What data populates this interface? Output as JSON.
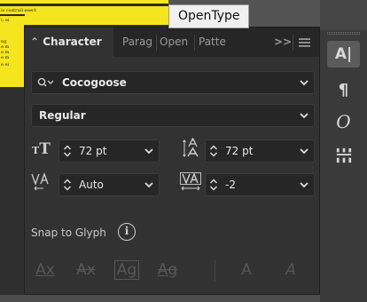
{
  "document": {
    "line1": "is costruil esect",
    "line2": "i: ei",
    "lines_left": [
      "ng",
      "e m",
      "e m",
      "e m",
      "e ei"
    ]
  },
  "tooltip": "OpenType",
  "tabs": [
    {
      "label": "Character"
    },
    {
      "label": "Parag"
    },
    {
      "label": "Open"
    },
    {
      "label": "Patte"
    }
  ],
  "overflow_label": ">>",
  "font_family": "Cocogoose",
  "font_style": "Regular",
  "font_size": "72 pt",
  "leading": "72 pt",
  "kerning": "Auto",
  "tracking": "-2",
  "snap_label": "Snap to Glyph",
  "info_glyph": "i",
  "glyph_buttons": [
    "Ax",
    "Ax",
    "Ag",
    "Ag",
    "A",
    "A"
  ],
  "right_tools": {
    "character": "A|",
    "paragraph": "¶",
    "opentype": "O",
    "glyphs": "⌸"
  },
  "colors": {
    "panel": "#323232",
    "tabbar": "#262626",
    "field": "#262626",
    "highlight": "#f5e51e"
  }
}
